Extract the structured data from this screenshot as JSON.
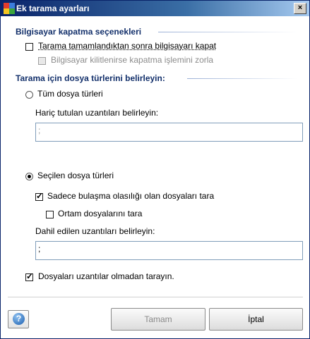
{
  "window": {
    "title": "Ek tarama ayarları",
    "close_glyph": "×"
  },
  "shutdown_section": {
    "heading": "Bilgisayar kapatma seçenekleri",
    "shutdown_after_scan": {
      "label": "Tarama tamamlandıktan sonra bilgisayarı kapat",
      "checked": false
    },
    "force_shutdown_locked": {
      "label": "Bilgisayar kilitlenirse kapatma işlemini zorla",
      "checked": false,
      "disabled": true
    }
  },
  "file_types_section": {
    "heading": "Tarama için dosya türlerini belirleyin:",
    "all_types": {
      "label": "Tüm dosya türleri",
      "selected": false
    },
    "excluded_ext_label": "Hariç tutulan uzantıları belirleyin:",
    "excluded_ext_value": ";",
    "selected_types": {
      "label": "Seçilen dosya türleri",
      "selected": true
    },
    "scan_infectable": {
      "label": "Sadece bulaşma olasılığı olan dosyaları tara",
      "checked": true
    },
    "scan_media": {
      "label": "Ortam dosyalarını tara",
      "checked": false
    },
    "included_ext_label": "Dahil edilen uzantıları belirleyin:",
    "included_ext_value": ";",
    "scan_no_ext": {
      "label": "Dosyaları uzantılar olmadan tarayın.",
      "checked": true
    }
  },
  "footer": {
    "help_icon": "?",
    "ok_label": "Tamam",
    "cancel_label": "İptal"
  },
  "colors": {
    "accent": "#13306b",
    "titlebar": "#0a246a"
  },
  "icons": {
    "app": "avg-logo-icon",
    "help": "help-icon"
  }
}
